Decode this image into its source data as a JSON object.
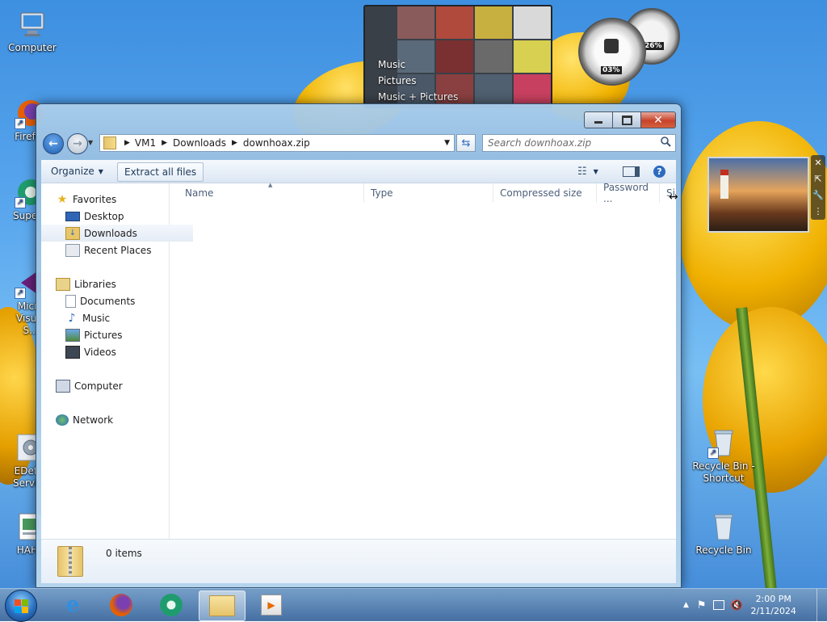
{
  "desktop": {
    "icons": [
      {
        "label": "Computer"
      },
      {
        "label": "Firefox"
      },
      {
        "label": "Superm..."
      },
      {
        "label": "Micro Visual S..."
      },
      {
        "label": "EDefer Service"
      },
      {
        "label": "HAHA"
      }
    ],
    "recycle_shortcut_label": "Recycle Bin - Shortcut",
    "recycle_label": "Recycle Bin"
  },
  "media_gadget": {
    "items": [
      "Music",
      "Pictures",
      "Music + Pictures"
    ]
  },
  "cpu_gadget": {
    "cpu": "03%",
    "mem": "26%"
  },
  "window": {
    "address": {
      "root": "VM1",
      "folder": "Downloads",
      "file": "downhoax.zip"
    },
    "search_placeholder": "Search downhoax.zip",
    "toolbar": {
      "organize": "Organize",
      "extract": "Extract all files"
    },
    "nav": {
      "favorites": "Favorites",
      "desktop": "Desktop",
      "downloads": "Downloads",
      "recent": "Recent Places",
      "libraries": "Libraries",
      "documents": "Documents",
      "music": "Music",
      "pictures": "Pictures",
      "videos": "Videos",
      "computer": "Computer",
      "network": "Network"
    },
    "columns": [
      "Name",
      "Type",
      "Compressed size",
      "Password ...",
      "Si"
    ],
    "status": "0 items"
  },
  "clock": {
    "time": "2:00 PM",
    "date": "2/11/2024"
  },
  "colors": {
    "accent": "#3a6fb5",
    "close": "#c7432a"
  }
}
